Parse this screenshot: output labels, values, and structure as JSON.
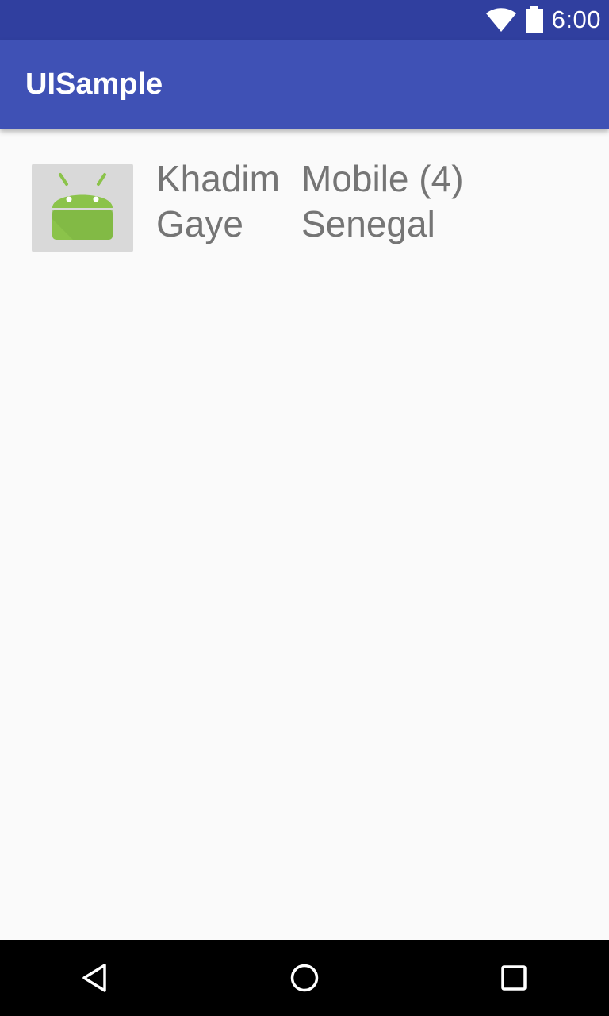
{
  "status_bar": {
    "time": "6:00",
    "icons": [
      "wifi-icon",
      "battery-icon"
    ],
    "background": "#303f9f"
  },
  "app_bar": {
    "title": "UISample",
    "background": "#3f51b5"
  },
  "list": {
    "items": [
      {
        "thumbnail_icon": "android-icon",
        "first_name": "Khadim",
        "last_name": "Gaye",
        "category": "Mobile (4)",
        "country": "Senegal"
      }
    ]
  },
  "nav_bar": {
    "buttons": [
      "back-icon",
      "home-icon",
      "recents-icon"
    ]
  }
}
